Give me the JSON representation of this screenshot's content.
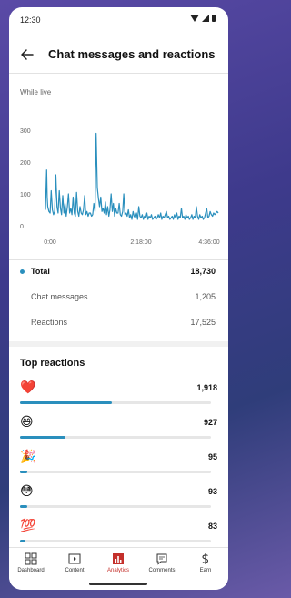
{
  "status_bar": {
    "time": "12:30"
  },
  "header": {
    "title": "Chat messages and reactions"
  },
  "chart_data": {
    "type": "line",
    "title": "While live",
    "x_ticks": [
      "0:00",
      "2:18:00",
      "4:36:00"
    ],
    "y_ticks": [
      0,
      100,
      200,
      300
    ],
    "ylim": [
      0,
      300
    ],
    "xlim_minutes": [
      0,
      300
    ],
    "series": [
      {
        "color": "#2a8fbd",
        "x": [
          0,
          2,
          3,
          4,
          6,
          8,
          10,
          12,
          14,
          16,
          18,
          20,
          22,
          24,
          26,
          28,
          30,
          32,
          34,
          36,
          38,
          40,
          42,
          44,
          46,
          48,
          50,
          52,
          54,
          56,
          58,
          60,
          62,
          64,
          66,
          68,
          70,
          72,
          74,
          76,
          78,
          80,
          82,
          84,
          86,
          88,
          90,
          92,
          94,
          96,
          98,
          100,
          102,
          104,
          106,
          108,
          110,
          112,
          114,
          116,
          118,
          120,
          122,
          124,
          126,
          128,
          130,
          132,
          134,
          136,
          138,
          140,
          142,
          144,
          146,
          148,
          150,
          152,
          154,
          156,
          158,
          160,
          162,
          164,
          166,
          168,
          170,
          172,
          174,
          176,
          178,
          180,
          182,
          184,
          186,
          188,
          190,
          192,
          194,
          196,
          198,
          200,
          202,
          204,
          206,
          208,
          210,
          212,
          214,
          216,
          218,
          220,
          222,
          224,
          226,
          228,
          230,
          232,
          234,
          236,
          238,
          240,
          242,
          244,
          246,
          248,
          250,
          252,
          254,
          256,
          258,
          260,
          262,
          264,
          266,
          268,
          270,
          272,
          274,
          276,
          278,
          280,
          282,
          284,
          286,
          288,
          290,
          292,
          294,
          296,
          298,
          300
        ],
        "values": [
          50,
          175,
          90,
          60,
          45,
          40,
          110,
          50,
          35,
          45,
          160,
          60,
          40,
          110,
          55,
          35,
          95,
          40,
          70,
          30,
          60,
          100,
          40,
          55,
          35,
          90,
          40,
          30,
          105,
          45,
          30,
          60,
          40,
          35,
          50,
          95,
          35,
          45,
          30,
          40,
          40,
          30,
          35,
          70,
          45,
          290,
          120,
          85,
          60,
          90,
          45,
          55,
          40,
          75,
          35,
          60,
          30,
          50,
          100,
          45,
          70,
          30,
          55,
          40,
          40,
          70,
          35,
          30,
          45,
          100,
          35,
          40,
          30,
          50,
          25,
          35,
          20,
          45,
          30,
          25,
          40,
          20,
          60,
          30,
          25,
          35,
          20,
          30,
          25,
          40,
          20,
          30,
          25,
          35,
          20,
          25,
          30,
          20,
          25,
          35,
          25,
          40,
          20,
          30,
          25,
          35,
          45,
          25,
          30,
          20,
          25,
          30,
          20,
          35,
          25,
          40,
          20,
          30,
          25,
          55,
          25,
          30,
          20,
          35,
          25,
          30,
          20,
          25,
          35,
          20,
          30,
          25,
          60,
          30,
          20,
          35,
          25,
          30,
          20,
          25,
          40,
          55,
          25,
          30,
          45,
          35,
          30,
          40,
          35,
          40,
          45,
          40
        ]
      }
    ]
  },
  "summary": {
    "total_label": "Total",
    "total_value": "18,730",
    "chat_label": "Chat messages",
    "chat_value": "1,205",
    "reactions_label": "Reactions",
    "reactions_value": "17,525"
  },
  "top_reactions": {
    "title": "Top reactions",
    "items": [
      {
        "emoji": "❤️",
        "icon": "heart-emoji",
        "count": "1,918",
        "fraction": 0.48
      },
      {
        "emoji": "😄",
        "icon": "grinning-face-emoji",
        "count": "927",
        "fraction": 0.24
      },
      {
        "emoji": "🎉",
        "icon": "party-popper-emoji",
        "count": "95",
        "fraction": 0.04
      },
      {
        "emoji": "😳",
        "icon": "flushed-face-emoji",
        "count": "93",
        "fraction": 0.04
      },
      {
        "emoji": "💯",
        "icon": "hundred-points-emoji",
        "count": "83",
        "fraction": 0.03
      }
    ]
  },
  "nav": {
    "items": [
      {
        "label": "Dashboard",
        "icon": "dashboard-icon",
        "active": false
      },
      {
        "label": "Content",
        "icon": "content-icon",
        "active": false
      },
      {
        "label": "Analytics",
        "icon": "analytics-icon",
        "active": true
      },
      {
        "label": "Comments",
        "icon": "comments-icon",
        "active": false
      },
      {
        "label": "Earn",
        "icon": "earn-icon",
        "active": false
      }
    ],
    "active_color": "#c4302b"
  }
}
